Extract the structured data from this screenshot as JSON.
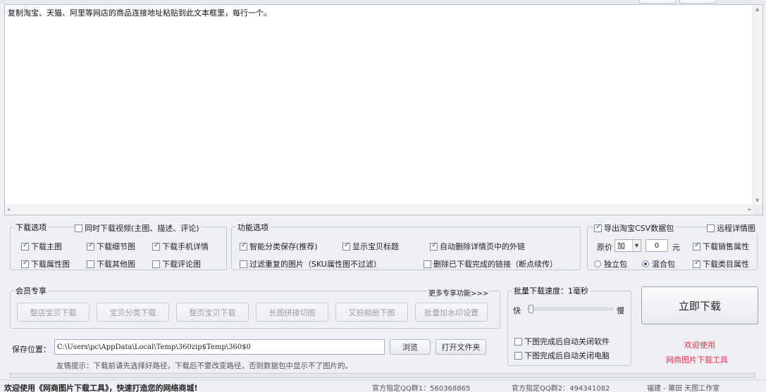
{
  "input_area": {
    "text": "复制淘宝、天猫、阿里等网店的商品连接地址粘贴到此文本框里，每行一个。"
  },
  "download_options": {
    "legend": "下载选项",
    "sync_video": {
      "label": "同时下载视频(主图、描述、评论)",
      "checked": false
    },
    "main_image": {
      "label": "下载主图",
      "checked": true
    },
    "detail_image": {
      "label": "下载细节图",
      "checked": true
    },
    "mobile_detail": {
      "label": "下载手机详情",
      "checked": true
    },
    "attr_image": {
      "label": "下载属性图",
      "checked": true
    },
    "other_image": {
      "label": "下载其他图",
      "checked": false
    },
    "review_image": {
      "label": "下载评论图",
      "checked": false
    }
  },
  "feature_options": {
    "legend": "功能选项",
    "smart_sort": {
      "label": "智能分类保存(推荐)",
      "checked": true
    },
    "show_title": {
      "label": "显示宝贝标题",
      "checked": true
    },
    "auto_remove_links": {
      "label": "自动删除详情页中的外链",
      "checked": true
    },
    "filter_duplicates": {
      "label": "过滤重复的图片（SKU属性图不过滤）",
      "checked": false
    },
    "delete_downloaded_links": {
      "label": "删除已下载完成的链接（断点续传）",
      "checked": false
    }
  },
  "csv_options": {
    "export_csv": {
      "label": "导出淘宝CSV数据包",
      "checked": true
    },
    "remote_detail": {
      "label": "远程详情图",
      "checked": false
    },
    "price_label": "原价",
    "price_op": "加",
    "price_value": "0",
    "price_unit": "元",
    "sales_attr": {
      "label": "下载销售属性",
      "checked": true
    },
    "standalone_pkg": {
      "label": "独立包",
      "selected": false
    },
    "combined_pkg": {
      "label": "混合包",
      "selected": true
    },
    "category_attr": {
      "label": "下载类目属性",
      "checked": true
    }
  },
  "member": {
    "legend": "会员专享",
    "more_link": "更多专享功能>>>",
    "buttons": [
      "整店宝贝下载",
      "宝贝分类下载",
      "整页宝贝下载",
      "长图拼接切图",
      "又拍相册下图",
      "批量加水印设置"
    ]
  },
  "save": {
    "label": "保存位置：",
    "path": "C:\\Users\\pc\\AppData\\Local\\Temp\\360zip$Temp\\360$0",
    "browse": "浏览",
    "open_folder": "打开文件夹",
    "tip": "友情提示：下载前请先选择好路径，下载后不要改变路径，否则数据包中显示不了图片的。"
  },
  "speed": {
    "legend": "批量下载速度：1毫秒",
    "fast": "快",
    "slow": "慢",
    "level": 0.0,
    "close_software": {
      "label": "下图完成后自动关闭软件",
      "checked": false
    },
    "shutdown": {
      "label": "下图完成后自动关闭电脑",
      "checked": false
    }
  },
  "actions": {
    "download_now": "立即下载",
    "welcome_line1": "欢迎使用",
    "welcome_line2": "网商图片下载工具"
  },
  "status": {
    "welcome": "欢迎使用《网商图片下载工具》，快速打造您的网络商城!",
    "qq1": "官方指定QQ群1：560368865",
    "qq2": "官方指定QQ群2：494341082",
    "company": "福建 - 莆田 天图工作室"
  },
  "colors": {
    "accent_red": "#e8324b",
    "check_blue": "#2b4ea0"
  }
}
